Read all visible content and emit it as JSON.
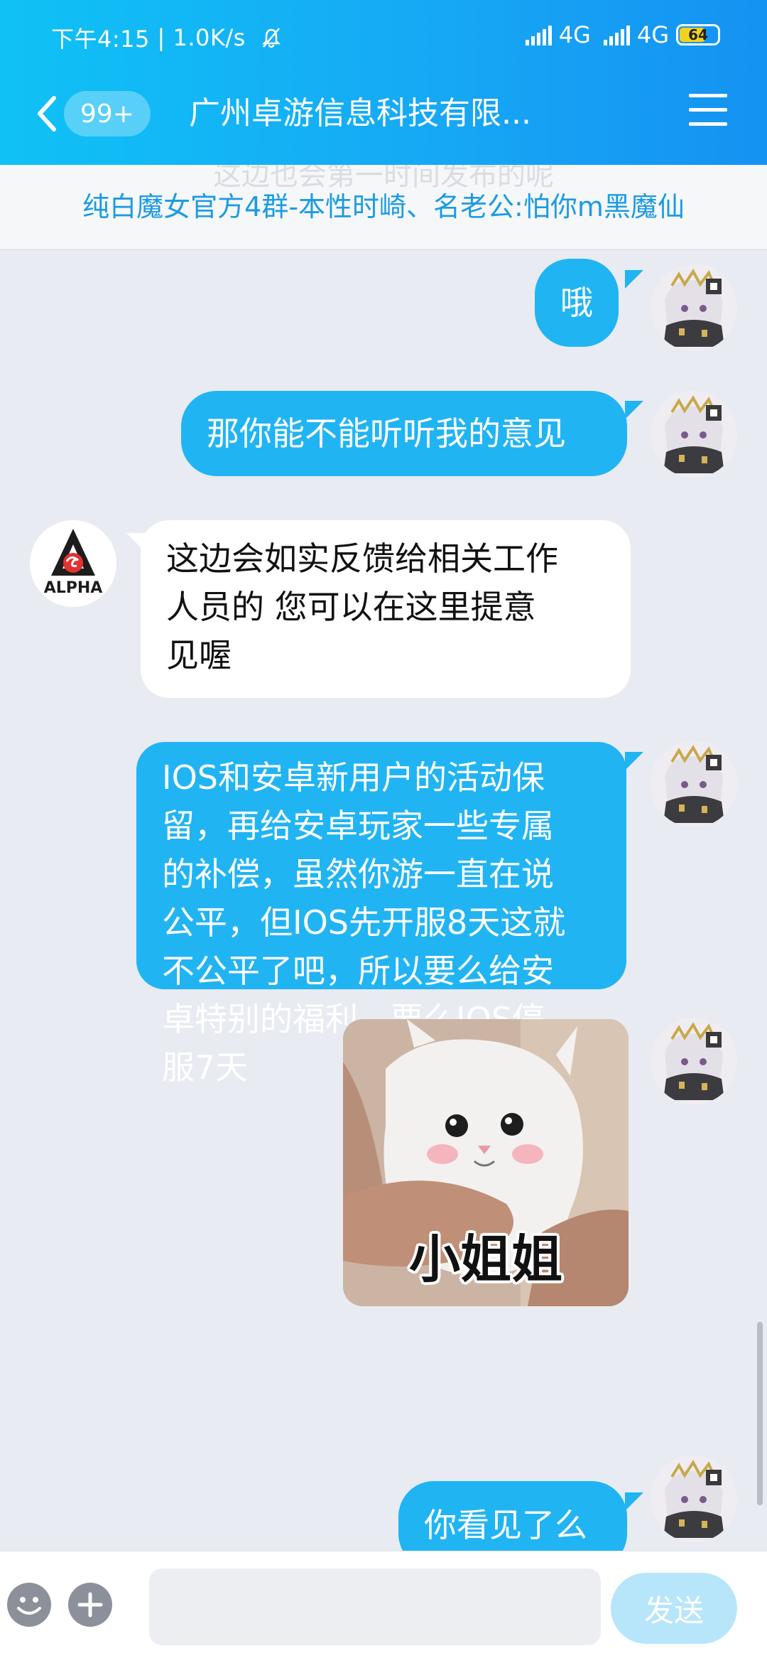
{
  "status_bar": {
    "time": "下午4:15",
    "speed": "1.0K/s",
    "network1": "4G",
    "network2": "4G",
    "battery": "64"
  },
  "nav": {
    "unread": "99+",
    "title": "广州卓游信息科技有限..."
  },
  "announcement": {
    "ghost_text": "这边也会第一时间发布的呢",
    "text": "纯白魔女官方4群-本性时崎、名老公:怕你m黑魔仙"
  },
  "messages": [
    {
      "from": "me",
      "text": "哦"
    },
    {
      "from": "me",
      "text": "那你能不能听听我的意见"
    },
    {
      "from": "other",
      "lines": [
        "这边会如实反馈给相关工作",
        "人员的 您可以在这里提意",
        "见喔"
      ]
    },
    {
      "from": "me",
      "lines": [
        "IOS和安卓新用户的活动保",
        "留，再给安卓玩家一些专属",
        "的补偿，虽然你游一直在说",
        "公平，但IOS先开服8天这就",
        "不公平了吧，所以要么给安",
        "卓特别的福利，要么IOS停",
        "服7天"
      ]
    },
    {
      "from": "me",
      "type": "sticker",
      "caption": "小姐姐"
    },
    {
      "from": "me",
      "text": "你看见了么"
    }
  ],
  "other_avatar_label": "ALPHA",
  "input": {
    "placeholder": "",
    "send_label": "发送"
  },
  "colors": {
    "header": "#16a9f5",
    "my_bubble": "#21b4f3",
    "other_bubble": "#ffffff",
    "send_button": "#b7e6fb"
  }
}
